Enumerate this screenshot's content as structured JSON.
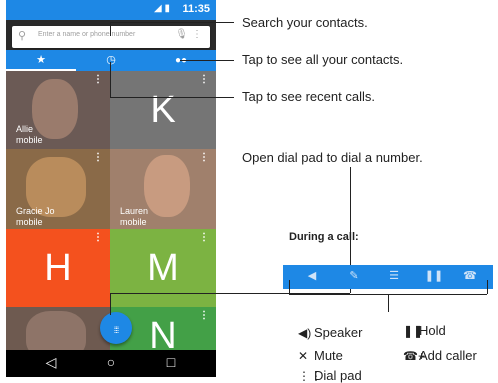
{
  "status_bar": {
    "time": "11:35",
    "icons": "◢ ▮"
  },
  "search": {
    "placeholder": "Enter a name or phone number",
    "icon": "search-icon",
    "mic": "microphone-icon",
    "more": "more-vert-icon"
  },
  "tabs": [
    {
      "name": "favorites",
      "glyph": "★"
    },
    {
      "name": "recents",
      "glyph": "◷"
    },
    {
      "name": "contacts",
      "glyph": "👥"
    }
  ],
  "tiles": [
    {
      "name": "Allie",
      "type": "mobile",
      "letter": "",
      "color": "#6b5a55"
    },
    {
      "name": "",
      "type": "",
      "letter": "K",
      "color": "#757575"
    },
    {
      "name": "Gracie Jo",
      "type": "mobile",
      "letter": "",
      "color": "#8a6a48"
    },
    {
      "name": "Lauren",
      "type": "mobile",
      "letter": "",
      "color": "#a0806c"
    },
    {
      "name": "",
      "type": "",
      "letter": "H",
      "color": "#f4511e"
    },
    {
      "name": "",
      "type": "",
      "letter": "M",
      "color": "#7cb342"
    },
    {
      "name": "",
      "type": "",
      "letter": "",
      "color": "#6e5a50"
    },
    {
      "name": "",
      "type": "",
      "letter": "N",
      "color": "#43a047"
    }
  ],
  "more_glyph": "⋮",
  "fab_glyph": "⋮⋮⋮",
  "nav": {
    "back": "◁",
    "home": "○",
    "recents": "□"
  },
  "callouts": {
    "search": "Search your contacts.",
    "all_contacts": "Tap to see all your contacts.",
    "recent_calls": "Tap to see recent calls.",
    "dial_pad": "Open dial pad to dial a number."
  },
  "during_call": {
    "title": "During a call:",
    "icons": [
      "◀",
      "✎",
      "☰",
      "❚❚",
      "☎"
    ],
    "legend": [
      {
        "glyph": "◀)",
        "label": "Speaker"
      },
      {
        "glyph": "❚❚",
        "label": "Hold"
      },
      {
        "glyph": "✕",
        "label": "Mute"
      },
      {
        "glyph": "☎+",
        "label": "Add caller"
      },
      {
        "glyph": "⋮⋮",
        "label": "Dial pad"
      }
    ]
  },
  "colors": {
    "accent": "#1e88e5",
    "nav": "#000000"
  }
}
